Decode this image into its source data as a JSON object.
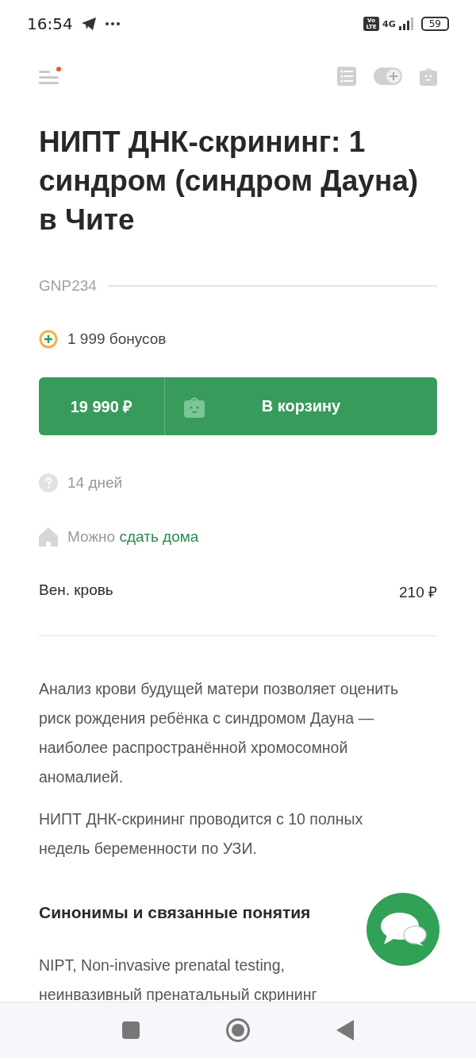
{
  "status_bar": {
    "time": "16:54",
    "battery": "59",
    "network": "4G",
    "volte": "Vo LTE"
  },
  "header": {
    "menu_has_notification": true
  },
  "title": "НИПТ ДНК-скрининг: 1 синдром (синдром Дауна) в Чите",
  "code": "GNP234",
  "bonus": "1 999 бонусов",
  "cart_button": {
    "price": "19 990 ₽",
    "label": "В корзину"
  },
  "duration": "14 дней",
  "home_collection": {
    "text": "Можно",
    "link": "сдать дома"
  },
  "biomaterial": {
    "name": "Вен. кровь",
    "price": "210 ₽"
  },
  "description": [
    "Анализ крови будущей матери позволяет оценить риск рождения ребёнка с синдромом Дауна — наиболее распространённой хромосомной аномалией.",
    "НИПТ ДНК-скрининг проводится с 10 полных недель беременности по УЗИ."
  ],
  "synonyms": {
    "heading": "Синонимы и связанные понятия",
    "text": "NIPT, Non-invasive prenatal testing, неинвазивный пренатальный скрининг"
  }
}
